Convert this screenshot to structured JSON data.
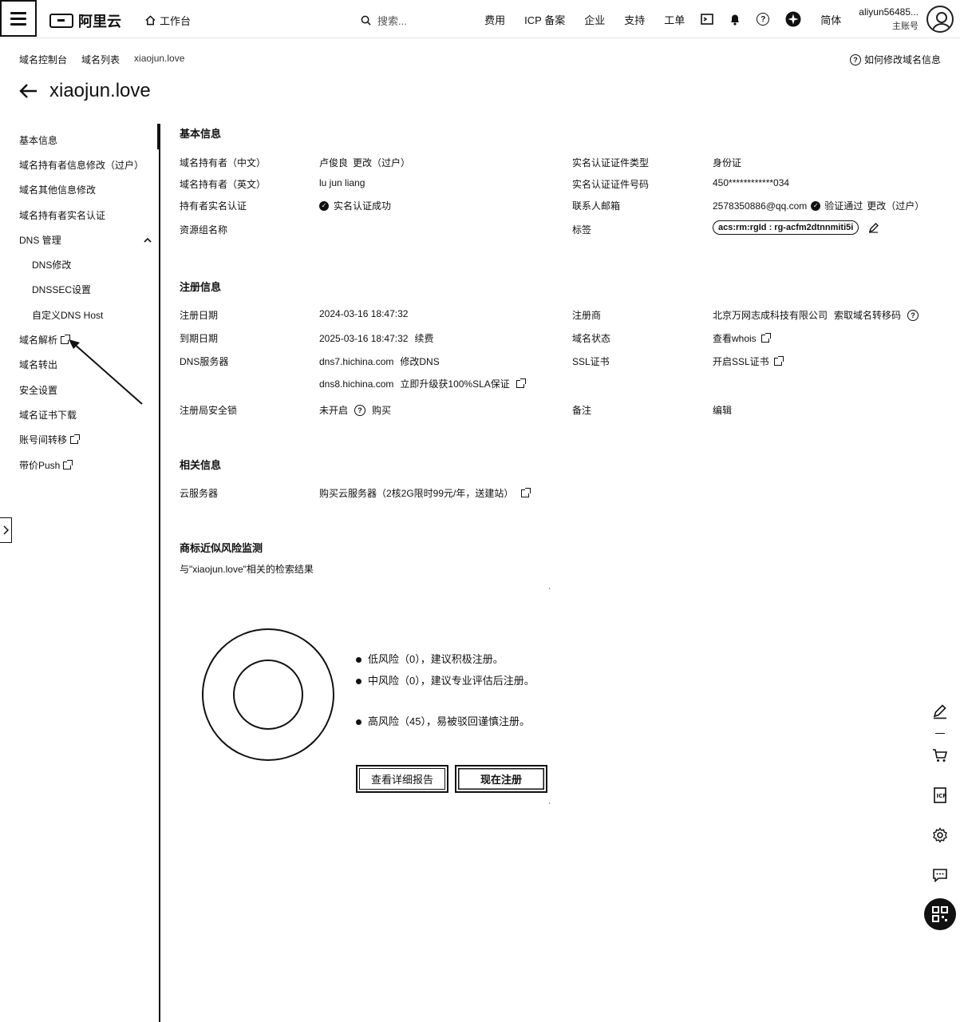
{
  "topbar": {
    "brand": "阿里云",
    "workbench": "工作台",
    "search_placeholder": "搜索...",
    "nav": [
      "费用",
      "ICP 备案",
      "企业",
      "支持",
      "工单"
    ],
    "lang": "简体",
    "user_name": "aliyun56485...",
    "user_role": "主账号"
  },
  "breadcrumb": [
    "域名控制台",
    "域名列表",
    "xiaojun.love"
  ],
  "help_link": "如何修改域名信息",
  "page_title": "xiaojun.love",
  "sidebar": {
    "items": [
      {
        "label": "基本信息"
      },
      {
        "label": "域名持有者信息修改（过户）"
      },
      {
        "label": "域名其他信息修改"
      },
      {
        "label": "域名持有者实名认证"
      },
      {
        "label": "DNS 管理"
      },
      {
        "label": "DNS修改"
      },
      {
        "label": "DNSSEC设置"
      },
      {
        "label": "自定义DNS Host"
      },
      {
        "label": "域名解析"
      },
      {
        "label": "域名转出"
      },
      {
        "label": "安全设置"
      },
      {
        "label": "域名证书下载"
      },
      {
        "label": "账号间转移"
      },
      {
        "label": "带价Push"
      }
    ]
  },
  "basic": {
    "title": "基本信息",
    "holder_cn_label": "域名持有者（中文）",
    "holder_cn_value": "卢俊良",
    "holder_cn_action": "更改（过户）",
    "holder_en_label": "域名持有者（英文）",
    "holder_en_value": "lu jun liang",
    "realname_label": "持有者实名认证",
    "realname_value": "实名认证成功",
    "rg_label": "资源组名称",
    "cert_type_label": "实名认证证件类型",
    "cert_type_value": "身份证",
    "cert_no_label": "实名认证证件号码",
    "cert_no_value": "450************034",
    "email_label": "联系人邮箱",
    "email_value": "2578350886@qq.com",
    "email_verified": "验证通过",
    "email_action": "更改（过户）",
    "tag_label": "标签",
    "tag_value": "acs:rm:rgId : rg-acfm2dtnnmiti5i"
  },
  "registration": {
    "title": "注册信息",
    "reg_date_label": "注册日期",
    "reg_date_value": "2024-03-16 18:47:32",
    "exp_date_label": "到期日期",
    "exp_date_value": "2025-03-16 18:47:32",
    "renew": "续费",
    "dns_label": "DNS服务器",
    "dns1": "dns7.hichina.com",
    "dns_modify": "修改DNS",
    "dns2": "dns8.hichina.com",
    "dns_upgrade": "立即升级获100%SLA保证",
    "lock_label": "注册局安全锁",
    "lock_value": "未开启",
    "lock_buy": "购买",
    "registrar_label": "注册商",
    "registrar_value": "北京万网志成科技有限公司",
    "transfer_code": "索取域名转移码",
    "status_label": "域名状态",
    "status_value": "查看whois",
    "ssl_label": "SSL证书",
    "ssl_value": "开启SSL证书",
    "remark_label": "备注",
    "remark_value": "编辑"
  },
  "related": {
    "title": "相关信息",
    "server_label": "云服务器",
    "server_value": "购买云服务器（2核2G限时99元/年，送建站）"
  },
  "trademark": {
    "title": "商标近似风险监测",
    "subtitle": "与\"xiaojun.love\"相关的检索结果",
    "risk_low": "低风险（0），建议积极注册。",
    "risk_mid": "中风险（0），建议专业评估后注册。",
    "risk_high": "高风险（45），易被驳回谨慎注册。",
    "low_count": 0,
    "mid_count": 0,
    "high_count": 45,
    "btn_report": "查看详细报告",
    "btn_register": "现在注册"
  }
}
